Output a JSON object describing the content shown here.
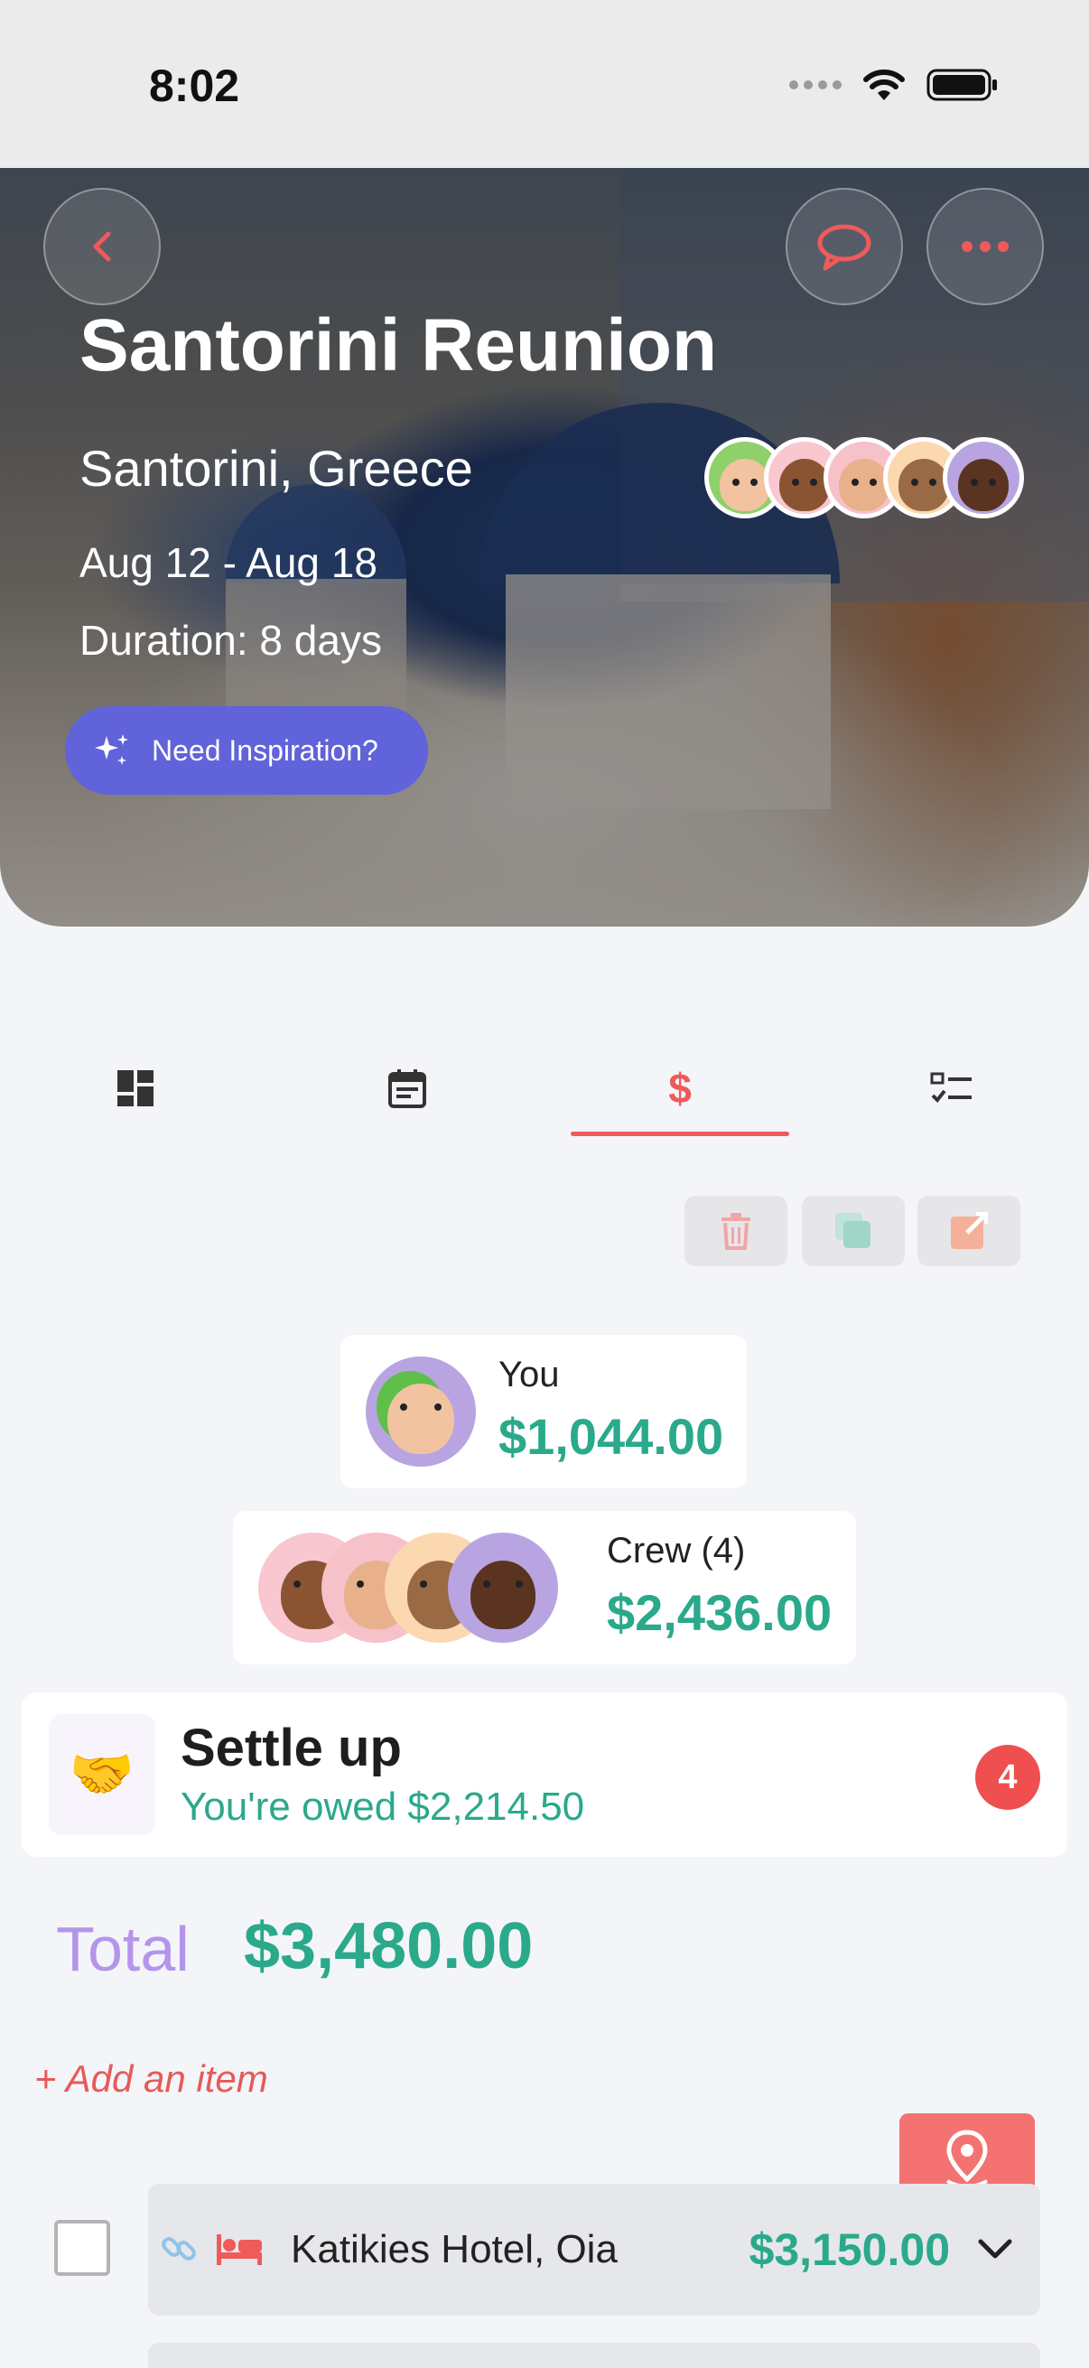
{
  "status_bar": {
    "time": "8:02"
  },
  "trip": {
    "title": "Santorini Reunion",
    "location": "Santorini, Greece",
    "dates": "Aug 12 - Aug 18",
    "duration": "Duration: 8 days",
    "inspiration_label": "Need Inspiration?"
  },
  "tabs": [
    {
      "name": "overview",
      "icon": "dashboard-icon"
    },
    {
      "name": "itinerary",
      "icon": "calendar-icon"
    },
    {
      "name": "expenses",
      "icon": "dollar-icon",
      "active": true
    },
    {
      "name": "checklist",
      "icon": "checklist-icon"
    }
  ],
  "balances": {
    "you": {
      "label": "You",
      "amount": "$1,044.00"
    },
    "crew": {
      "label": "Crew (4)",
      "amount": "$2,436.00"
    }
  },
  "settle": {
    "title": "Settle up",
    "subtitle": "You're owed $2,214.50",
    "badge": "4",
    "icon": "handshake-icon"
  },
  "total": {
    "label": "Total",
    "amount": "$3,480.00"
  },
  "add_item_label": "+ Add an item",
  "items": [
    {
      "name": "Katikies Hotel, Oia",
      "price": "$3,150.00",
      "category_icon": "bed-icon"
    }
  ],
  "colors": {
    "accent_red": "#ef5a5a",
    "money_green": "#2aa98b",
    "inspiration_purple": "#6063d9",
    "total_purple": "#b595ea"
  }
}
